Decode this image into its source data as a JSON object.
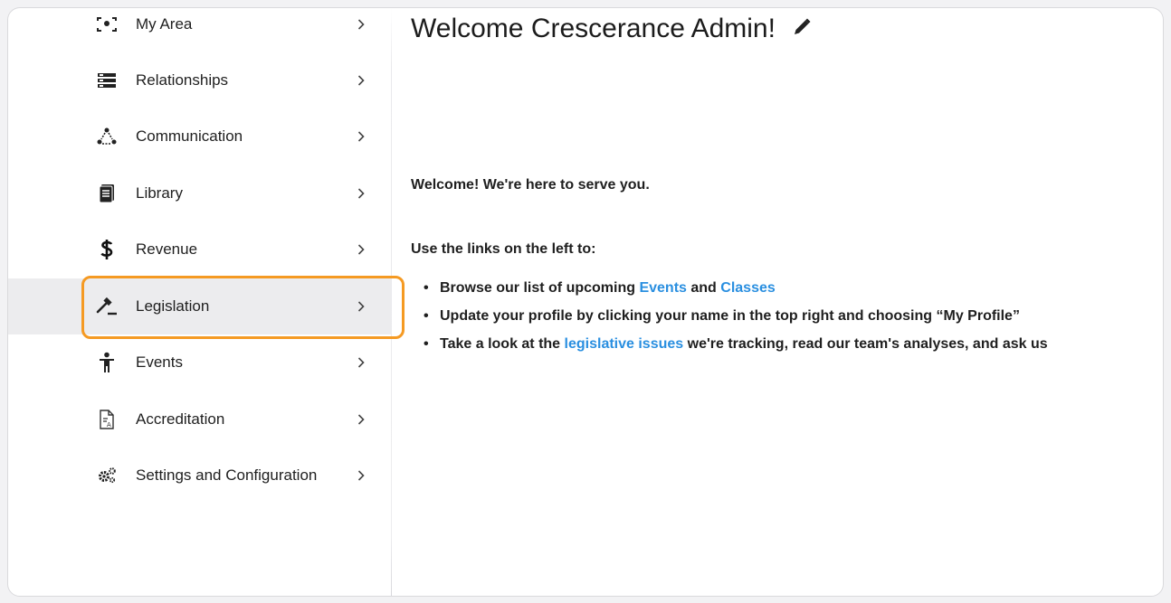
{
  "sidebar": {
    "items": [
      {
        "label": "My Area",
        "icon": "my-area-icon"
      },
      {
        "label": "Relationships",
        "icon": "relationships-icon"
      },
      {
        "label": "Communication",
        "icon": "communication-icon"
      },
      {
        "label": "Library",
        "icon": "library-icon"
      },
      {
        "label": "Revenue",
        "icon": "dollar-icon"
      },
      {
        "label": "Legislation",
        "icon": "gavel-icon",
        "active": true
      },
      {
        "label": "Events",
        "icon": "person-icon"
      },
      {
        "label": "Accreditation",
        "icon": "document-icon"
      },
      {
        "label": "Settings and Configuration",
        "icon": "gears-icon"
      }
    ],
    "chevron": "›"
  },
  "main": {
    "title": "Welcome Crescerance Admin!",
    "welcome": "Welcome!  We're here to serve you.",
    "intro": "Use the links on the left to:",
    "bullet1": {
      "prefix": "Browse our list of upcoming ",
      "link1": "Events",
      "mid": " and ",
      "link2": "Classes"
    },
    "bullet2": {
      "text": "Update your profile by clicking your name in the top right and choosing “My Profile”"
    },
    "bullet3": {
      "prefix": "Take a look at the ",
      "link": "legislative issues",
      "suffix": " we're tracking, read our team's analyses, and ask us"
    }
  },
  "colors": {
    "accent_link": "#2a8fe0",
    "highlight": "#f59a23",
    "active_bg": "#ececee"
  }
}
